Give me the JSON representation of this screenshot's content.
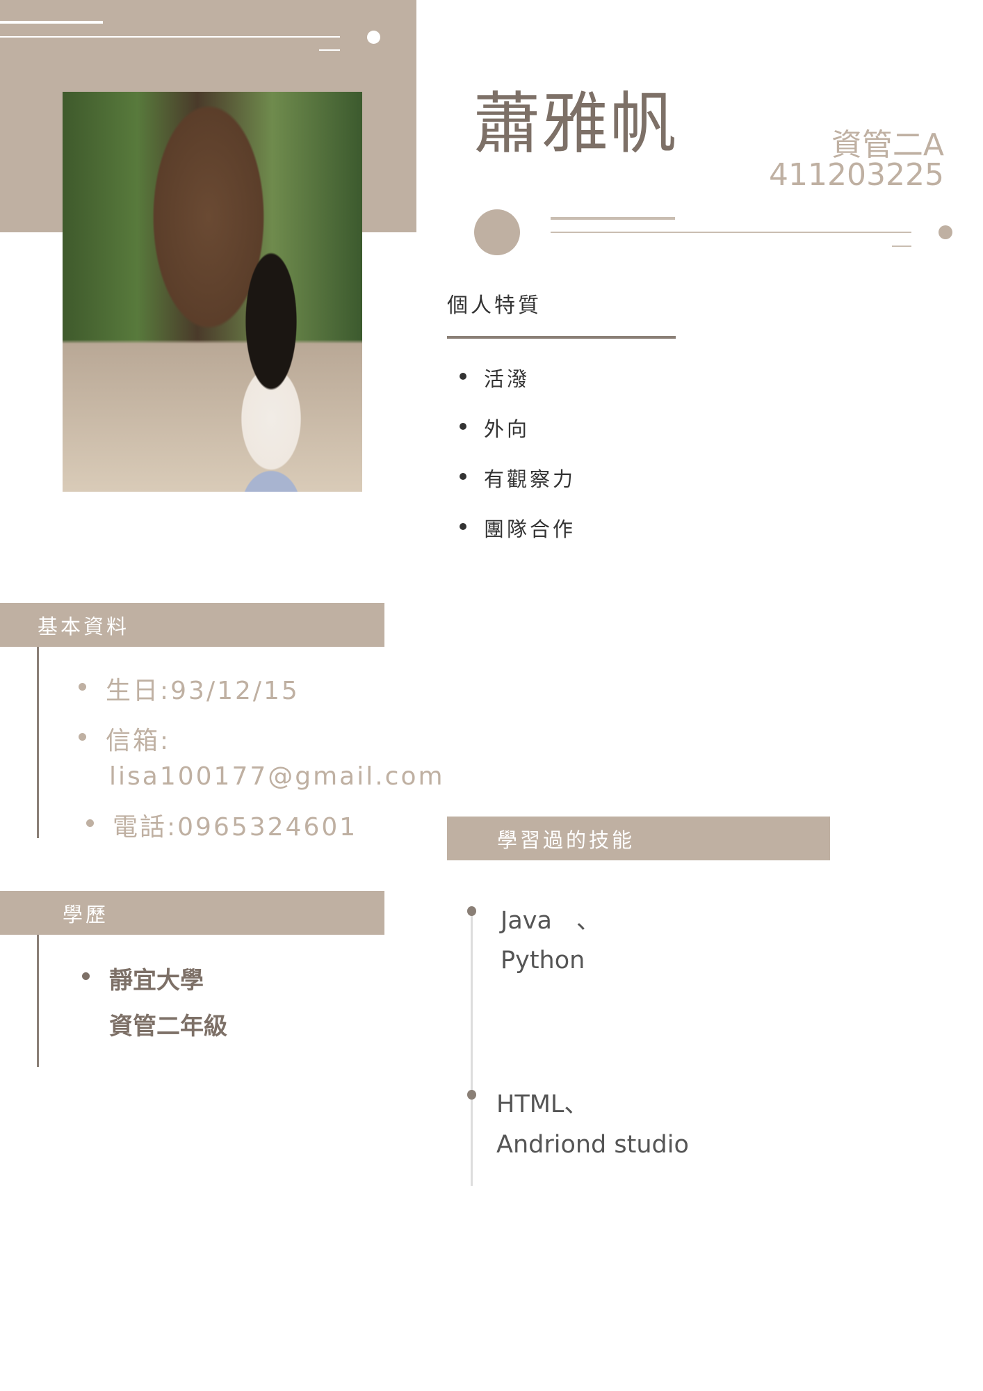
{
  "header": {
    "name": "蕭雅帆",
    "class": "資管二A",
    "student_id": "411203225"
  },
  "photo": {
    "alt": "profile-photo"
  },
  "traits": {
    "title": "個人特質",
    "items": [
      "活潑",
      "外向",
      "有觀察力",
      "團隊合作"
    ]
  },
  "basic_info": {
    "title": "基本資料",
    "birthday": "生日:93/12/15",
    "email_label": "信箱:",
    "email": "lisa100177@gmail.com",
    "phone": "電話:0965324601"
  },
  "education": {
    "title": "學歷",
    "school": "靜宜大學",
    "grade": "資管二年級"
  },
  "skills": {
    "title": "學習過的技能",
    "items": [
      {
        "line1": "Java　、",
        "line2": "Python"
      },
      {
        "line1": "HTML、",
        "line2": "Andriond studio"
      }
    ]
  },
  "colors": {
    "accent": "#bfb0a2",
    "dark": "#7d7067",
    "line": "#8a7f76"
  }
}
